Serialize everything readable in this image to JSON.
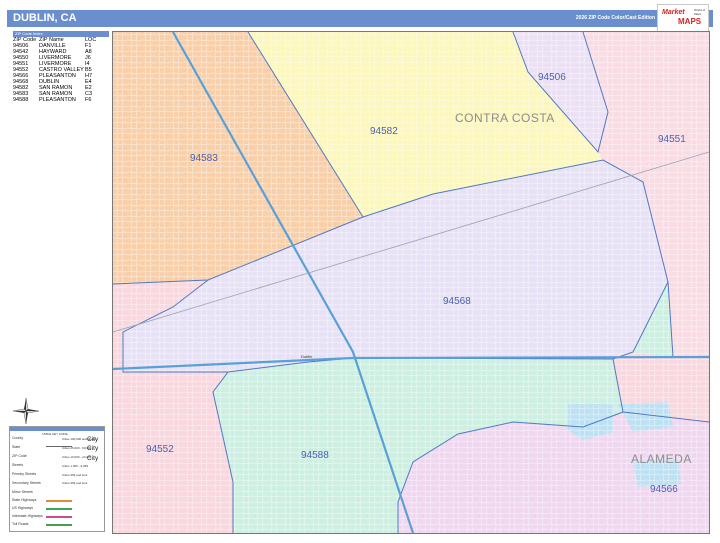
{
  "header": {
    "title": "DUBLIN, CA",
    "edition": "2026 ZIP Code Color/Cast Edition",
    "logo_line1": "Market",
    "logo_line2": "MAPS",
    "logo_small": "World of Maps"
  },
  "zip_table": {
    "caption": "ZIP Code Index",
    "headers": [
      "ZIP Code",
      "ZIP Name",
      "LOC"
    ],
    "rows": [
      [
        "94506",
        "DANVILLE",
        "F1"
      ],
      [
        "94542",
        "HAYWARD",
        "A8"
      ],
      [
        "94550",
        "LIVERMORE",
        "J6"
      ],
      [
        "94551",
        "LIVERMORE",
        "I4"
      ],
      [
        "94552",
        "CASTRO VALLEY",
        "B5"
      ],
      [
        "94566",
        "PLEASANTON",
        "H7"
      ],
      [
        "94568",
        "DUBLIN",
        "E4"
      ],
      [
        "94582",
        "SAN RAMON",
        "E2"
      ],
      [
        "94583",
        "SAN RAMON",
        "C3"
      ],
      [
        "94588",
        "PLEASANTON",
        "F6"
      ]
    ]
  },
  "map": {
    "zip_labels": [
      "94506",
      "94582",
      "94551",
      "94583",
      "94568",
      "94552",
      "94588",
      "94566"
    ],
    "county_labels": [
      "CONTRA COSTA",
      "ALAMEDA"
    ],
    "city_label": "Dublin",
    "zone_colors": {
      "94583": "#f9cfa9",
      "94582": "#fbf7bd",
      "94506": "#ece0f5",
      "94551": "#f9dce3",
      "94568": "#e7e1f5",
      "94552": "#f8d7de",
      "94588": "#cdefe1",
      "94566": "#efd8ef",
      "border": "#4f79c4",
      "water": "#bde0f3"
    }
  },
  "legend": {
    "title": "TABLE KEY CODE",
    "rows": [
      "County",
      "State",
      "ZIP Code",
      "Streets",
      "Primary Streets",
      "Secondary Streets",
      "Minor Streets",
      "State Highways",
      "US Highways",
      "Interstate Highways",
      "Toll Roads"
    ],
    "samples": [
      "Cities 100,000 and above",
      "Cities 25,000 - 99,999",
      "Cities 10,000 - 24,999",
      "Cities 1,000 - 9,999",
      "Cities 999 and less",
      "Cities 999 and less"
    ],
    "city_samples": [
      "City",
      "City",
      "City"
    ]
  }
}
